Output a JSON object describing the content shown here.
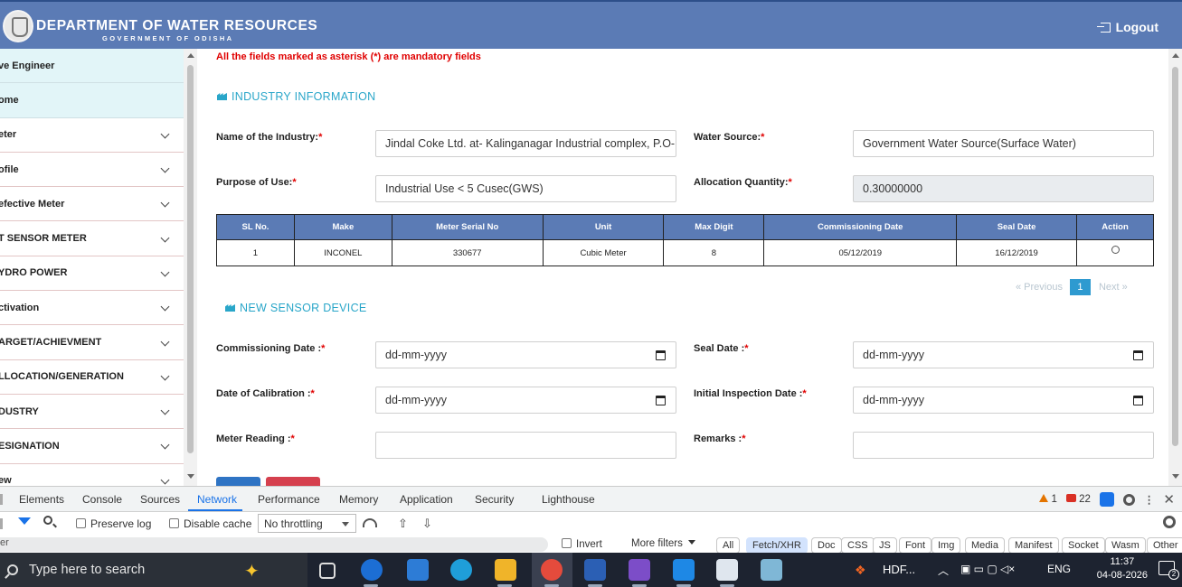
{
  "header": {
    "title": "DEPARTMENT OF WATER RESOURCES",
    "subtitle": "GOVERNMENT OF ODISHA",
    "logout_label": "Logout"
  },
  "sidebar": {
    "items": [
      {
        "label": "ve Engineer",
        "active": true,
        "expandable": false
      },
      {
        "label": "ome",
        "active": true,
        "expandable": false
      },
      {
        "label": "eter",
        "expandable": true
      },
      {
        "label": "ofile",
        "expandable": true
      },
      {
        "label": "efective Meter",
        "expandable": true
      },
      {
        "label": "T SENSOR METER",
        "expandable": true
      },
      {
        "label": "YDRO POWER",
        "expandable": true
      },
      {
        "label": "ctivation",
        "expandable": true
      },
      {
        "label": "ARGET/ACHIEVMENT",
        "expandable": true
      },
      {
        "label": "LLOCATION/GENERATION",
        "expandable": true
      },
      {
        "label": "DUSTRY",
        "expandable": true
      },
      {
        "label": "ESIGNATION",
        "expandable": true
      },
      {
        "label": "ew",
        "expandable": true
      }
    ]
  },
  "form": {
    "mandatory_note": "All the fields marked as asterisk (*) are mandatory fields",
    "industry_section": "INDUSTRY INFORMATION",
    "sensor_section": "NEW SENSOR DEVICE",
    "required_mark": "*",
    "industry_name": {
      "label": "Name of the Industry:",
      "value": "Jindal Coke Ltd. at- Kalinganagar Industrial complex, P.O- Duburi"
    },
    "water_source": {
      "label": "Water Source:",
      "value": "Government Water Source(Surface Water)"
    },
    "purpose": {
      "label": "Purpose of Use:",
      "value": "Industrial Use < 5 Cusec(GWS)"
    },
    "allocation": {
      "label": "Allocation Quantity:",
      "value": "0.30000000"
    },
    "commissioning_date": {
      "label": "Commissioning Date :",
      "placeholder": "dd-mm-yyyy"
    },
    "seal_date": {
      "label": "Seal Date :",
      "placeholder": "dd-mm-yyyy"
    },
    "calibration_date": {
      "label": "Date of Calibration :",
      "placeholder": "dd-mm-yyyy"
    },
    "inspection_date": {
      "label": "Initial Inspection Date :",
      "placeholder": "dd-mm-yyyy"
    },
    "meter_reading": {
      "label": "Meter Reading :",
      "value": ""
    },
    "remarks": {
      "label": "Remarks :",
      "value": ""
    }
  },
  "table": {
    "headers": [
      "SL No.",
      "Make",
      "Meter Serial No",
      "Unit",
      "Max Digit",
      "Commissioning Date",
      "Seal Date",
      "Action"
    ],
    "rows": [
      [
        "1",
        "INCONEL",
        "330677",
        "Cubic Meter",
        "8",
        "05/12/2019",
        "16/12/2019",
        ""
      ]
    ]
  },
  "pagination": {
    "previous": "« Previous",
    "current": "1",
    "next": "Next »"
  },
  "devtools": {
    "tabs": [
      "Elements",
      "Console",
      "Sources",
      "Network",
      "Performance",
      "Memory",
      "Application",
      "Security",
      "Lighthouse"
    ],
    "active_tab": "Network",
    "warning_count": "1",
    "error_count": "22",
    "preserve_log": "Preserve log",
    "disable_cache": "Disable cache",
    "throttling": "No throttling",
    "filter_text": "er",
    "invert": "Invert",
    "more_filters": "More filters",
    "type_filters": [
      "All",
      "Fetch/XHR",
      "Doc",
      "CSS",
      "JS",
      "Font",
      "Img",
      "Media",
      "Manifest",
      "Socket",
      "Wasm",
      "Other"
    ],
    "active_type_filter": "Fetch/XHR"
  },
  "taskbar": {
    "search_placeholder": "Type here to search",
    "tray_app": "HDF...",
    "language": "ENG",
    "time": "11:37",
    "date": "04-08-2026",
    "notification_count": "2"
  },
  "colors": {
    "header": "#5b7bb5",
    "accent": "#29a6c9",
    "required": "#e00000",
    "devtools_active": "#1a73e8"
  }
}
